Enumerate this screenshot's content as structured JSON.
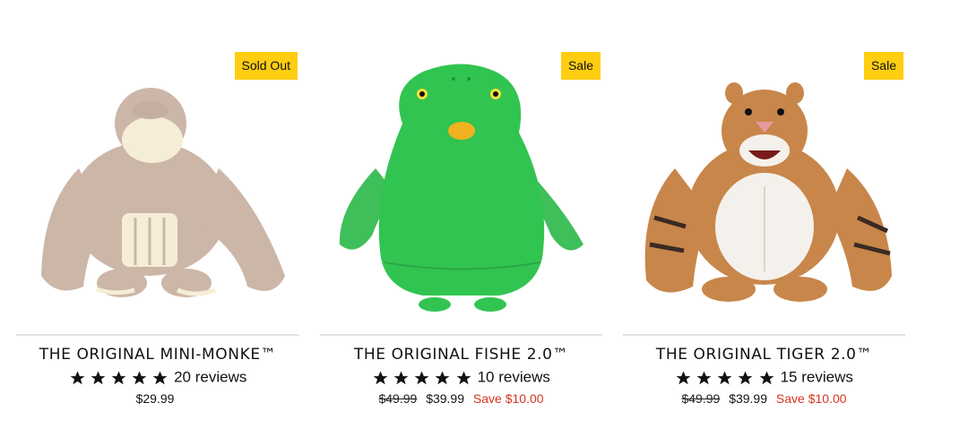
{
  "products": [
    {
      "badge": "Sold Out",
      "title": "THE ORIGINAL MINI-MONKE™",
      "rating_stars": 5,
      "reviews": "20 reviews",
      "price": "$29.99",
      "compare_price": "",
      "save": "",
      "image": "gorilla-toy-image",
      "sold_out": true
    },
    {
      "badge": "Sale",
      "title": "THE ORIGINAL FISHE 2.0™",
      "rating_stars": 5,
      "reviews": "10 reviews",
      "compare_price": "$49.99",
      "price": "$39.99",
      "save": "Save $10.00",
      "image": "green-fish-toy-image",
      "sold_out": false
    },
    {
      "badge": "Sale",
      "title": "THE ORIGINAL TIGER 2.0™",
      "rating_stars": 5,
      "reviews": "15 reviews",
      "compare_price": "$49.99",
      "price": "$39.99",
      "save": "Save $10.00",
      "image": "tiger-toy-image",
      "sold_out": false
    }
  ],
  "colors": {
    "badge": "#ffcd11",
    "save": "#d4351c",
    "divider": "#e3e3e3"
  }
}
